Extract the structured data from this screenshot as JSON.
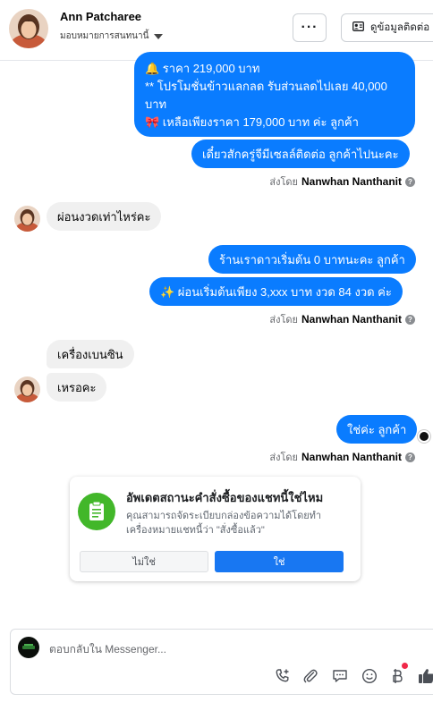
{
  "header": {
    "contact_name": "Ann Patcharee",
    "assign_label": "มอบหมายการสนทนานี้",
    "more_label": "···",
    "contact_info_label": "ดูข้อมูลติดต่อ"
  },
  "messages": {
    "m1_line1": "🔔 ราคา 219,000 บาท",
    "m1_line2": "** โปรโมชั่นข้าวแลกลด รับส่วนลดไปเลย 40,000",
    "m1_line3": "บาท",
    "m1_line4": "🎀 เหลือเพียงราคา 179,000 บาท ค่ะ ลูกค้า",
    "m2": "เดี๋ยวสักครู่จีมีเซลล์ติดต่อ ลูกค้าไปนะคะ",
    "m3": "ผ่อนงวดเท่าไหร่คะ",
    "m4": "ร้านเราดาวเริ่มต้น 0 บาทนะคะ ลูกค้า",
    "m5": "✨ ผ่อนเริ่มต้นเพียง 3,xxx บาท งวด 84 งวด ค่ะ",
    "m6": "เครื่องเบนซิน",
    "m7": "เหรอคะ",
    "m8": "ใช่ค่ะ ลูกค้า"
  },
  "sent_by": {
    "prefix": "ส่งโดย",
    "agent": "Nanwhan Nanthanit"
  },
  "order_card": {
    "title": "อัพเดตสถานะคำสั่งซื้อของแชทนี้ใช่ไหม",
    "description": "คุณสามารถจัดระเบียบกล่องข้อความได้โดยทำเครื่องหมายแชทนี้ว่า \"สั่งซื้อแล้ว\"",
    "no_label": "ไม่ใช่",
    "yes_label": "ใช่"
  },
  "composer": {
    "placeholder": "ตอบกลับใน Messenger..."
  },
  "icons": [
    "more-icon",
    "contact-card-icon",
    "help-icon",
    "order-clipboard-icon",
    "add-call-icon",
    "attach-icon",
    "saved-reply-icon",
    "emoji-icon",
    "currency-icon",
    "thumbs-up-icon"
  ],
  "colors": {
    "outgoing_bubble": "#0a7cff",
    "incoming_bubble": "#f0f0f0",
    "primary_button": "#1877f2",
    "card_icon_bg": "#42b72a",
    "notification_dot": "#f02849"
  }
}
